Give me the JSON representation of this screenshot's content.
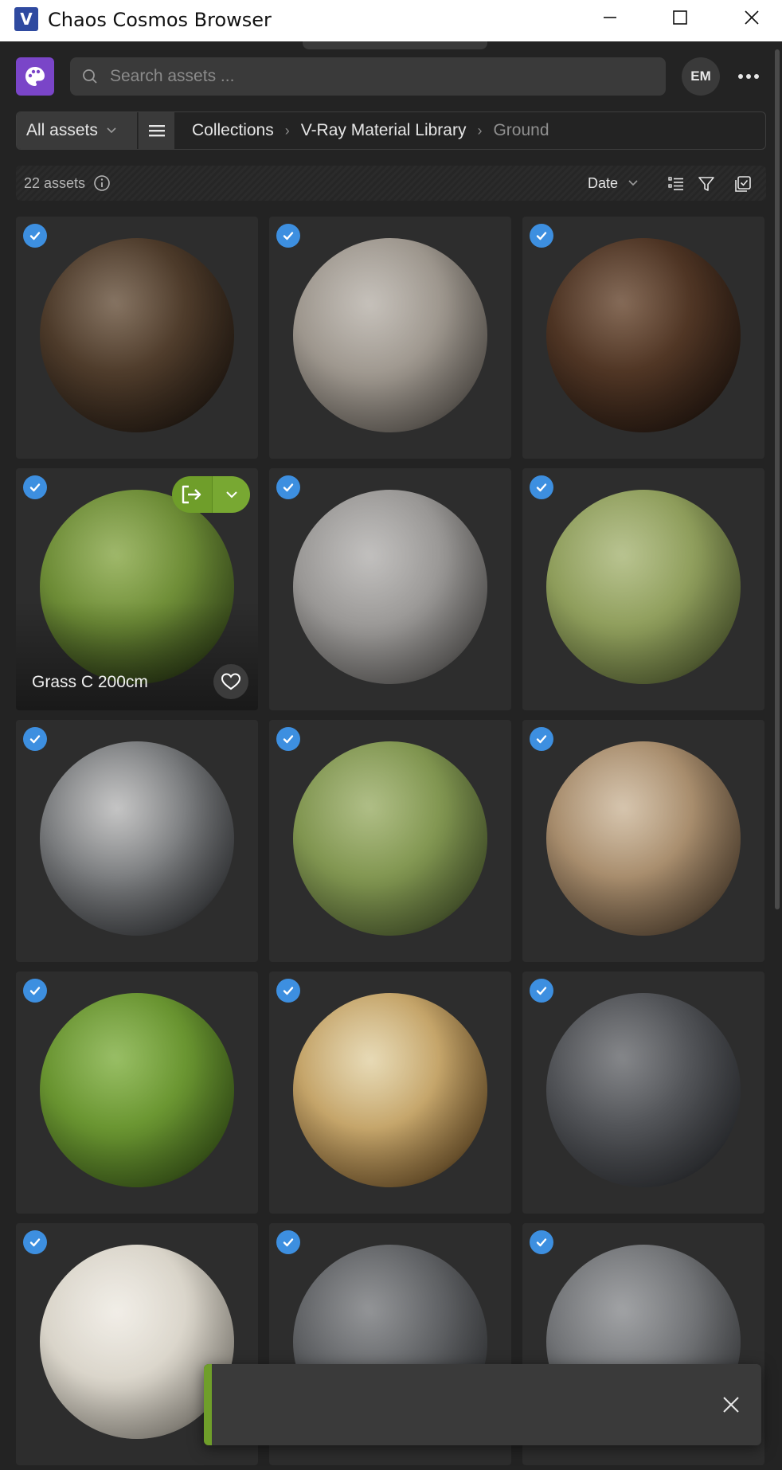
{
  "window": {
    "title": "Chaos Cosmos Browser",
    "logo_letter": "V"
  },
  "header": {
    "search_placeholder": "Search assets ...",
    "avatar_initials": "EM"
  },
  "breadcrumb": {
    "scope_label": "All assets",
    "items": [
      "Collections",
      "V-Ray Material Library",
      "Ground"
    ]
  },
  "toolbar": {
    "asset_count": "22 assets",
    "sort_label": "Date"
  },
  "grid": {
    "hovered_asset_name": "Grass C 200cm",
    "materials": [
      "dark-soil",
      "light-gray-soil",
      "dark-brown-soil",
      "green-grass",
      "gray-concrete",
      "light-green-grass",
      "black-white-gravel",
      "green-moss-grass",
      "mixed-gravel",
      "bright-green-grass",
      "yellow-stone-pebbles",
      "dark-asphalt",
      "white-plaster",
      "gray-rough-stone",
      "gray-concrete-2"
    ]
  },
  "toast": {
    "message": ""
  },
  "colors": {
    "accent_green": "#6f9e2a",
    "check_blue": "#3d8fe0",
    "brand_purple": "#7a45c8"
  }
}
